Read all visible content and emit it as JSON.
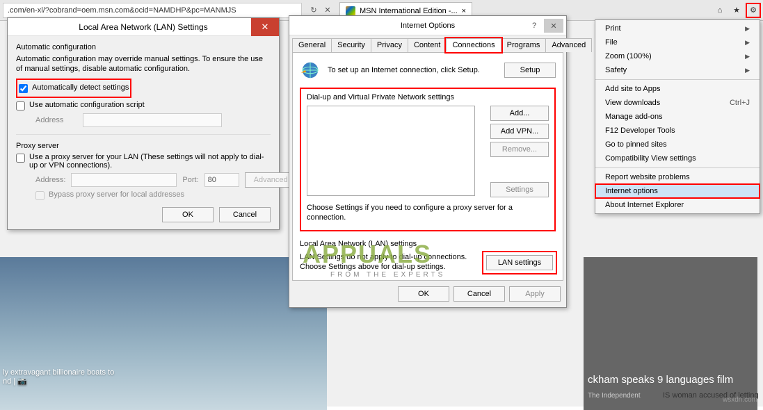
{
  "browser": {
    "url": ".com/en-xl/?cobrand=oem.msn.com&ocid=NAMDHP&pc=MANMJS",
    "tab_title": "MSN International Edition -..."
  },
  "page": {
    "hero_left_line1": "ly extravagant billionaire boats to",
    "hero_left_line2": "nd | 📷",
    "hero_right_caption": "ckham speaks 9 languages film",
    "hero_right_source": "The Independent",
    "right_snip": "IS woman accused of letting"
  },
  "lan": {
    "title": "Local Area Network (LAN) Settings",
    "auto_cfg_heading": "Automatic configuration",
    "auto_cfg_desc": "Automatic configuration may override manual settings. To ensure the use of manual settings, disable automatic configuration.",
    "auto_detect_label": "Automatically detect settings",
    "use_script_label": "Use automatic configuration script",
    "address_label": "Address",
    "proxy_heading": "Proxy server",
    "proxy_desc": "Use a proxy server for your LAN (These settings will not apply to dial-up or VPN connections).",
    "addr_label": "Address:",
    "port_label": "Port:",
    "port_value": "80",
    "advanced_btn": "Advanced",
    "bypass_label": "Bypass proxy server for local addresses",
    "ok": "OK",
    "cancel": "Cancel"
  },
  "io": {
    "title": "Internet Options",
    "tabs": {
      "general": "General",
      "security": "Security",
      "privacy": "Privacy",
      "content": "Content",
      "connections": "Connections",
      "programs": "Programs",
      "advanced": "Advanced"
    },
    "setup_text": "To set up an Internet connection, click Setup.",
    "setup_btn": "Setup",
    "dialup_heading": "Dial-up and Virtual Private Network settings",
    "add_btn": "Add...",
    "addvpn_btn": "Add VPN...",
    "remove_btn": "Remove...",
    "settings_btn": "Settings",
    "choose_note": "Choose Settings if you need to configure a proxy server for a connection.",
    "lan_heading": "Local Area Network (LAN) settings",
    "lan_note": "LAN Settings do not apply to dial-up connections. Choose Settings above for dial-up settings.",
    "lan_btn": "LAN settings",
    "ok": "OK",
    "cancel": "Cancel",
    "apply": "Apply"
  },
  "menu": {
    "print": "Print",
    "file": "File",
    "zoom": "Zoom (100%)",
    "safety": "Safety",
    "add_site": "Add site to Apps",
    "downloads": "View downloads",
    "downloads_shortcut": "Ctrl+J",
    "addons": "Manage add-ons",
    "f12": "F12 Developer Tools",
    "pinned": "Go to pinned sites",
    "compat": "Compatibility View settings",
    "report": "Report website problems",
    "options": "Internet options",
    "about": "About Internet Explorer"
  },
  "watermark": {
    "main": "APPUALS",
    "sub": "FROM THE EXPERTS",
    "corner": "wsxdn.com"
  }
}
